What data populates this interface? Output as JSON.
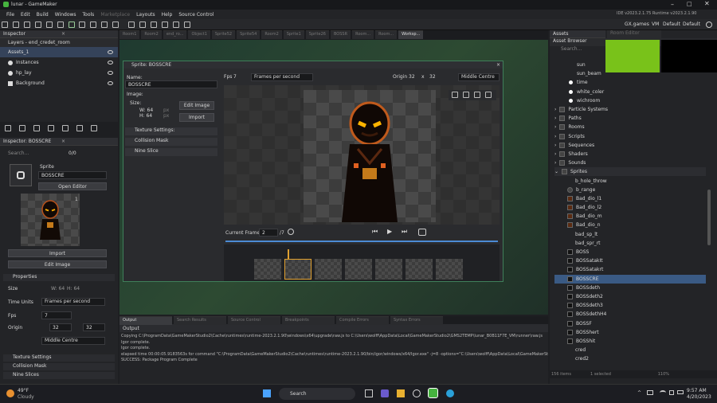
{
  "window": {
    "title": "lunar - GameMaker",
    "right_info": "IDE v2023.2.1.75  Runtime v2023.2.1.90"
  },
  "menu": [
    "File",
    "Edit",
    "Build",
    "Windows",
    "Tools",
    "Marketplace",
    "Layouts",
    "Help",
    "Source Control"
  ],
  "toolbar_right": {
    "account": "GX.games",
    "config": "VM",
    "target": "Default",
    "default2": "Default"
  },
  "tabs": [
    "Room1",
    "Room2",
    "end_ro...",
    "Object1",
    "Sprite52",
    "Sprite54",
    "Room2",
    "Sprite1",
    "Sprite26",
    "BOSSR",
    "Room...",
    "Room...",
    "Worksp..."
  ],
  "layers": {
    "header": "Inspector",
    "subheader": "Layers - end_credet_room",
    "items": [
      "Assets_1",
      "Instances",
      "hp_lay",
      "Background"
    ]
  },
  "inspector": {
    "title": "Inspector: BOSSCRE",
    "search": "Search...",
    "count": "0/0",
    "kind": "Sprite",
    "name": "BOSSCRE",
    "open_editor": "Open Editor",
    "frame": "1",
    "import": "Import",
    "edit_image": "Edit Image",
    "properties": "Properties",
    "size_label": "Size",
    "w": "W: 64",
    "h": "H: 64",
    "time_units_label": "Time Units",
    "time_units": "Frames per second",
    "fps_label": "Fps",
    "fps": "7",
    "origin_label": "Origin",
    "ox": "32",
    "oy": "32",
    "origin_mode": "Middle Centre",
    "texture": "Texture Settings",
    "collision": "Collision Mask",
    "nine": "Nine Slices"
  },
  "sprite_editor": {
    "title": "Sprite: BOSSCRE",
    "name_label": "Name:",
    "name": "BOSSCRE",
    "image_label": "Image:",
    "size_label": "Size:",
    "w": "W: 64",
    "h": "H: 64",
    "px1": "px",
    "px2": "px",
    "edit_image": "Edit Image",
    "import": "Import",
    "texture": "Texture Settings:",
    "collision": "Collision Mask",
    "nine": "Nine Slice",
    "fps_label": "Fps",
    "fps": "7",
    "fps_mode": "Frames per second",
    "origin_label": "Origin",
    "ox": "32",
    "x": "x",
    "oy": "32",
    "origin_mode": "Middle Centre",
    "current_frame_label": "Current Frame:",
    "current_frame": "2",
    "total_frames": "/7"
  },
  "output": {
    "tabs": [
      "Output",
      "Search Results",
      "Source Control",
      "Breakpoints",
      "Compile Errors",
      "Syntax Errors"
    ],
    "sub": "Output",
    "lines": [
      "Copying C:\\ProgramData\\GameMakerStudio2\\Cache\\runtimes\\runtime-2023.2.1.90\\windows\\x64\\upgrade\\raw.js to C:\\Users\\wolff\\AppData\\Local\\GameMakerStudio2\\GMS2TEMP\\lunar_B0B11F7E_VM\\runner\\raw.js",
      "Igor complete.",
      "Igor complete.",
      "elapsed time 00:00:05.9183563s for command \"C:\\ProgramData\\GameMakerStudio2\\Cache\\runtimes\\runtime-2023.2.1.90/bin/igor/windows/x64/Igor.exe\" -j=8 -options=\"C:\\Users\\wolff\\AppData\\Local\\GameMakerStudio2\\GMS2TEMP\\build.bff\"",
      "SUCCESS: Package Program Complete"
    ]
  },
  "assets": {
    "header": "Assets",
    "browser": "Asset Browser",
    "search": "Search...",
    "items": [
      {
        "label": "sun",
        "kind": "obj"
      },
      {
        "label": "sun_beam",
        "kind": "obj"
      },
      {
        "label": "time",
        "kind": "obj"
      },
      {
        "label": "white_coler",
        "kind": "obj"
      },
      {
        "label": "wichroom",
        "kind": "obj"
      },
      {
        "label": "Particle Systems",
        "kind": "folder"
      },
      {
        "label": "Paths",
        "kind": "folder"
      },
      {
        "label": "Rooms",
        "kind": "folder"
      },
      {
        "label": "Scripts",
        "kind": "folder"
      },
      {
        "label": "Sequences",
        "kind": "folder"
      },
      {
        "label": "Shaders",
        "kind": "folder"
      },
      {
        "label": "Sounds",
        "kind": "folder"
      },
      {
        "label": "Sprites",
        "kind": "folder-open"
      },
      {
        "label": "b_hole_throw",
        "kind": "spr"
      },
      {
        "label": "b_range",
        "kind": "spr"
      },
      {
        "label": "Bad_dio_l1",
        "kind": "spr"
      },
      {
        "label": "Bad_dio_l2",
        "kind": "spr"
      },
      {
        "label": "Bad_dio_m",
        "kind": "spr"
      },
      {
        "label": "Bad_dio_n",
        "kind": "spr"
      },
      {
        "label": "bad_sp_lt",
        "kind": "spr"
      },
      {
        "label": "bad_spr_rt",
        "kind": "spr"
      },
      {
        "label": "BOSS",
        "kind": "spr"
      },
      {
        "label": "BOSSatakIt",
        "kind": "spr"
      },
      {
        "label": "BOSSatakrt",
        "kind": "spr"
      },
      {
        "label": "BOSSCRE",
        "kind": "spr",
        "selected": true
      },
      {
        "label": "BOSSdeth",
        "kind": "spr"
      },
      {
        "label": "BOSSdeth2",
        "kind": "spr"
      },
      {
        "label": "BOSSdeth3",
        "kind": "spr"
      },
      {
        "label": "BOSSdethH4",
        "kind": "spr"
      },
      {
        "label": "BOSSF",
        "kind": "spr"
      },
      {
        "label": "BOSShert",
        "kind": "spr"
      },
      {
        "label": "BOSShit",
        "kind": "spr"
      },
      {
        "label": "cred",
        "kind": "spr"
      },
      {
        "label": "cred2",
        "kind": "spr"
      }
    ],
    "status": "156 items",
    "selected": "1 selected",
    "zoom": "110%"
  },
  "taskbar": {
    "temp": "49°F",
    "weather": "Cloudy",
    "search": "Search",
    "time": "9:57 AM",
    "date": "4/20/2023"
  },
  "colors": {
    "accent": "#4b8bd4",
    "selected": "#3a5a84",
    "green": "#79c21a"
  }
}
